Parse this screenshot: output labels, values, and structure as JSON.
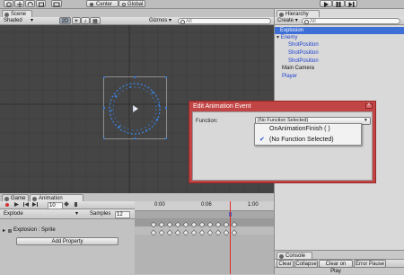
{
  "toolbar": {
    "pivot_label": "Center",
    "space_label": "Global",
    "play_icon": "play-icon",
    "pause_icon": "pause-icon",
    "step_icon": "step-icon"
  },
  "scene": {
    "tab_label": "Scene",
    "shading_mode": "Shaded",
    "mode_2d": "2D",
    "gizmos_label": "Gizmos",
    "search_placeholder": "All"
  },
  "hierarchy": {
    "tab_label": "Hierarchy",
    "create_label": "Create",
    "search_placeholder": "All",
    "items": [
      {
        "label": "Explosion",
        "selected": true
      },
      {
        "label": "Enemy",
        "color": "#1a3fd0"
      },
      {
        "label": "ShotPosition",
        "color": "#1a3fd0"
      },
      {
        "label": "ShotPosition",
        "color": "#1a3fd0"
      },
      {
        "label": "ShotPosition",
        "color": "#1a3fd0"
      },
      {
        "label": "Main Camera",
        "color": "#111111"
      },
      {
        "label": "Player",
        "color": "#1a3fd0"
      }
    ]
  },
  "event_dialog": {
    "title": "Edit Animation Event",
    "function_label": "Function:",
    "selected_value": "(No Function Selected)",
    "options": [
      {
        "label": "OnAnimationFinish ( )",
        "checked": false
      },
      {
        "label": "(No Function Selected)",
        "checked": true
      }
    ]
  },
  "animation": {
    "tab_game": "Game",
    "tab_animation": "Animation",
    "clip_name": "Explode",
    "samples_label": "Samples",
    "samples_value": "12",
    "frame_value": "10",
    "time_labels": [
      "0:00",
      "0:06",
      "1:00"
    ],
    "property_label": "Explosion : Sprite",
    "add_property_label": "Add Property"
  },
  "console": {
    "tab_label": "Console",
    "buttons": [
      "Clear",
      "Collapse",
      "Clear on Play",
      "Error Pause"
    ]
  },
  "colors": {
    "accent_selection": "#3d6fd6",
    "dialog_red": "#c24545",
    "playhead": "#e02b2b"
  }
}
